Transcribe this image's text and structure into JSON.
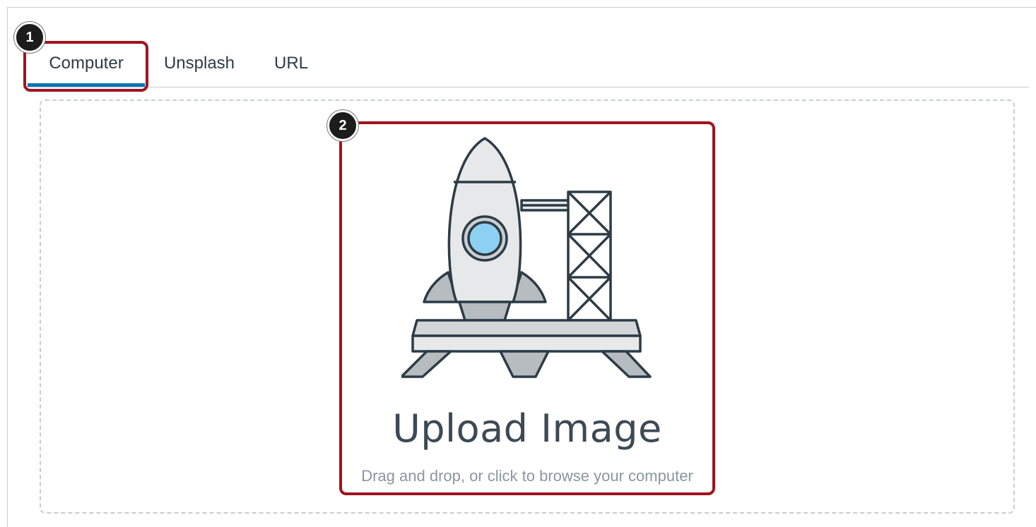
{
  "tabs": [
    {
      "label": "Computer",
      "selected": true
    },
    {
      "label": "Unsplash",
      "selected": false
    },
    {
      "label": "URL",
      "selected": false
    }
  ],
  "callouts": {
    "one": "1",
    "two": "2"
  },
  "upload": {
    "title": "Upload Image",
    "subtitle": "Drag and drop, or click to browse your computer",
    "illustration": "rocket-launchpad-icon"
  },
  "colors": {
    "accent": "#0374b5",
    "callout_border": "#a0141e",
    "text": "#2d3b45",
    "muted": "#8a969f",
    "porthole": "#8ed0f2"
  }
}
